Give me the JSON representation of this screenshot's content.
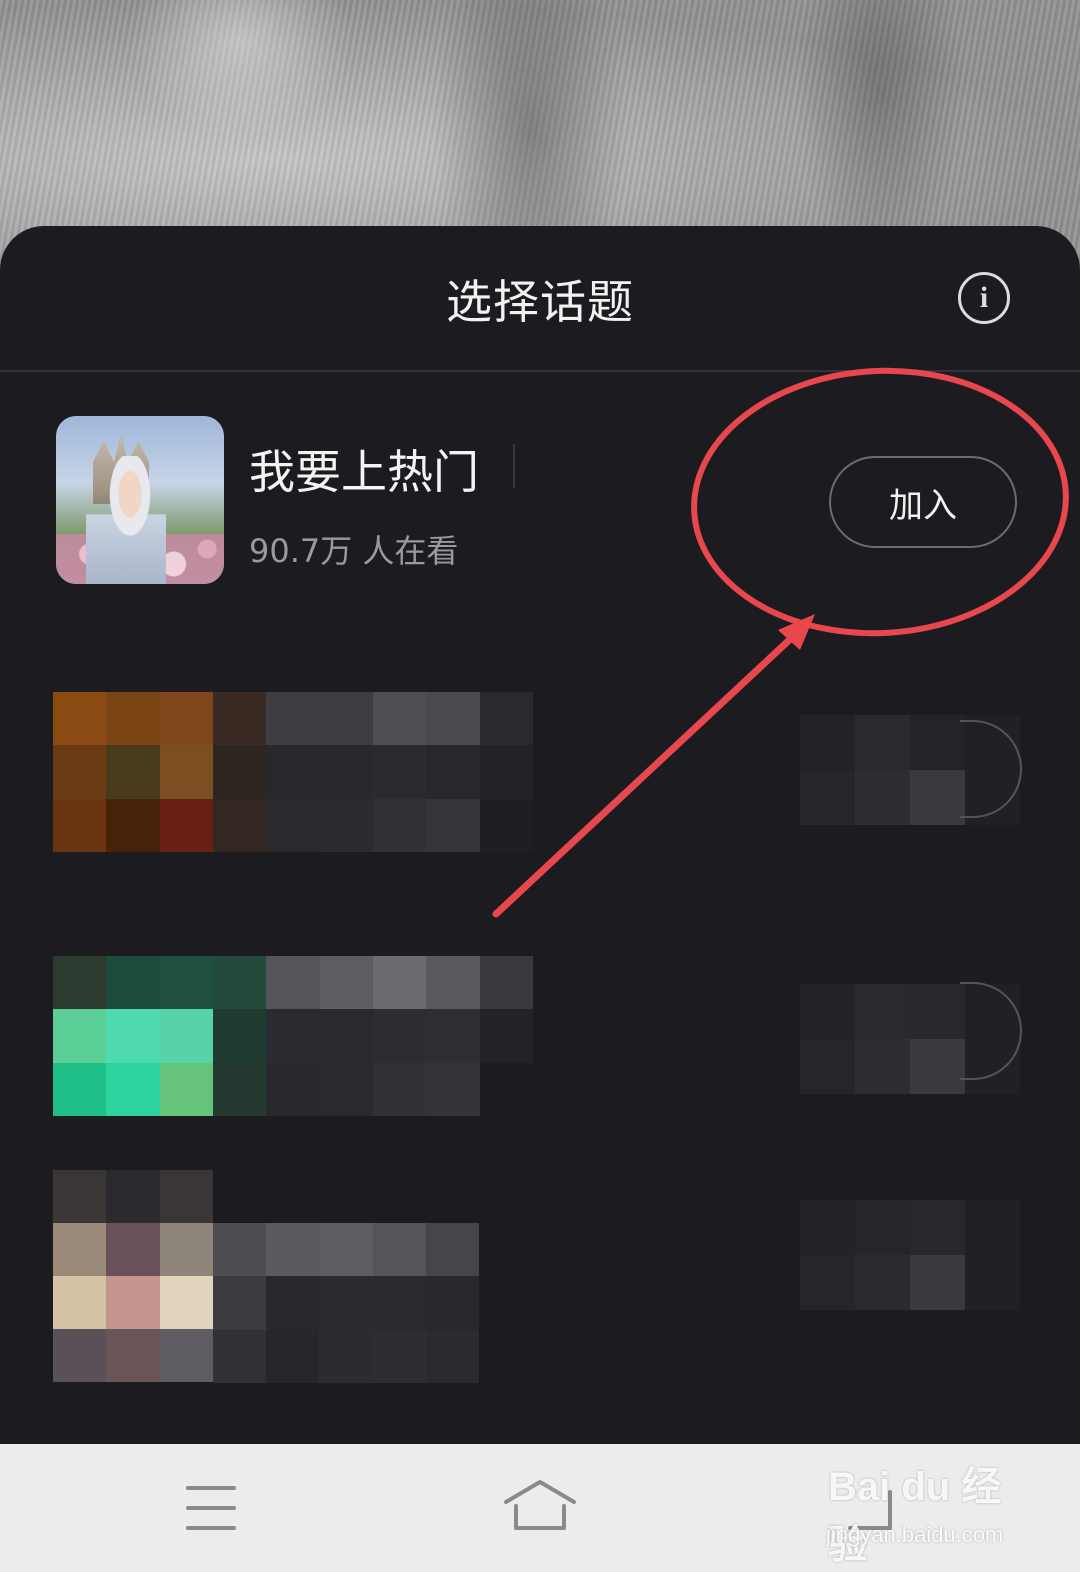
{
  "header": {
    "title": "选择话题",
    "info_icon": "info-circle-icon"
  },
  "topic": {
    "name": "我要上热门",
    "viewers": "90.7万 人在看",
    "join_label": "加入"
  },
  "annotation": {
    "color": "#e8474e",
    "shape": "ellipse-with-arrow"
  },
  "nav": {
    "menu_icon": "menu-icon",
    "home_icon": "home-icon",
    "back_icon": "back-icon"
  },
  "watermark": {
    "brand": "Bai du 经验",
    "url": "jingyan.baidu.com"
  },
  "colors": {
    "sheet_bg": "#1c1b20",
    "nav_bg": "#ececec",
    "accent_red": "#e8474e"
  }
}
